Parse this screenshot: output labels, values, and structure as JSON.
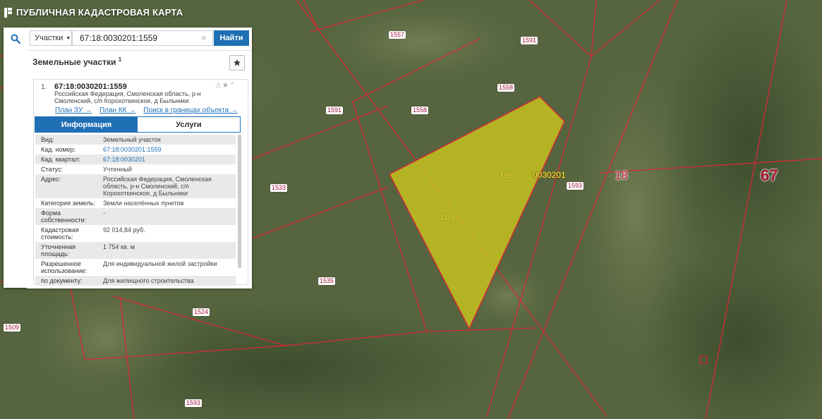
{
  "app": {
    "title": "ПУБЛИЧНАЯ КАДАСТРОВАЯ КАРТА"
  },
  "search": {
    "type_label": "Участки",
    "query": "67:18:0030201:1559",
    "find_label": "Найти"
  },
  "results": {
    "section_title": "Земельные участки",
    "count": "1",
    "item": {
      "index": "1.",
      "cad_number": "67:18:0030201:1559",
      "address": "Российская Федерация, Смоленская область, р-н Смоленский, с/п Корохоткинское, д Быльники",
      "links": [
        "План ЗУ →",
        "План КК →",
        "Поиск в границах объекта →"
      ]
    },
    "tabs": [
      "Информация",
      "Услуги"
    ],
    "info": [
      {
        "key": "Вид:",
        "value": "Земельный участок"
      },
      {
        "key": "Кад. номер:",
        "value": "67:18:0030201:1559",
        "link": true
      },
      {
        "key": "Кад. квартал:",
        "value": "67:18:0030201",
        "link": true
      },
      {
        "key": "Статус:",
        "value": "Учтенный"
      },
      {
        "key": "Адрес:",
        "value": "Российская Федерация, Смоленская область, р-н Смоленский, с/п Корохоткинское, д Быльники"
      },
      {
        "key": "Категория земель:",
        "value": "Земли населённых пунктов"
      },
      {
        "key": "Форма собственности:",
        "value": "-"
      },
      {
        "key": "Кадастровая стоимость:",
        "value": "92 014,84 руб."
      },
      {
        "key": "Уточненная площадь:",
        "value": "1 754 кв. м"
      },
      {
        "key": "Разрешенное использование:",
        "value": "Для индивидуальной жилой застройки"
      },
      {
        "key": "по документу:",
        "value": "Для жилищного строительства"
      }
    ]
  },
  "map": {
    "plot_labels": [
      "1557",
      "1591",
      "1558",
      "1591",
      "1558",
      "1533",
      "1593",
      "1535",
      "1524",
      "1509",
      "1593"
    ],
    "selected_labels": [
      "1559",
      "1559"
    ],
    "quarter_label": "0030201",
    "district_label": "18",
    "region_label": "67",
    "colors": {
      "boundary": "#d42a35",
      "selected_fill": "#c9c51e",
      "accent": "#1f6fb5"
    }
  }
}
